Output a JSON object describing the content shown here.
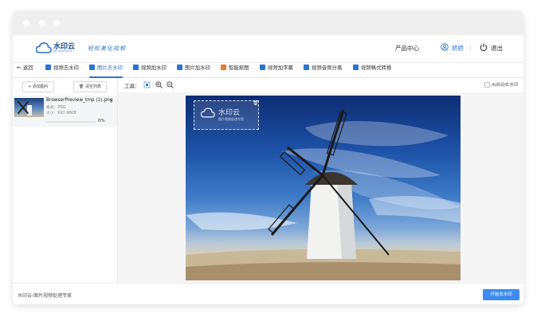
{
  "app": {
    "logo_text": "水印云",
    "logo_sub": "图片视频处理专家",
    "slogan": "轻松美化视频"
  },
  "topnav": {
    "product_center": "产品中心",
    "user_name": "娇娇",
    "logout": "退出"
  },
  "tabs": [
    {
      "label": "返回"
    },
    {
      "label": "视频去水印"
    },
    {
      "label": "图片去水印"
    },
    {
      "label": "视频加水印"
    },
    {
      "label": "图片加水印"
    },
    {
      "label": "智能抠图"
    },
    {
      "label": "视频加字幕"
    },
    {
      "label": "视频音频分离"
    },
    {
      "label": "视频格式转换"
    }
  ],
  "active_tab": "图片去水印",
  "sidebar": {
    "add_image": "+ 添加图片",
    "clear_list": "清空列表",
    "file": {
      "name": "BrowserPreview_tmp (1).png",
      "format": "格式：PNG",
      "size": "大小：697.98KB",
      "progress": "0%"
    }
  },
  "toolbar": {
    "tools_label": "工具：",
    "auto_remove_label": "AI自动去水印"
  },
  "watermark": {
    "text": "水印云",
    "sub": "图片视频处理专家"
  },
  "footer": {
    "tagline": "水印云-图片视频处理专家",
    "start_button": "开始去水印"
  },
  "colors": {
    "accent": "#2c74d4",
    "primary_button": "#3b8cf0"
  }
}
